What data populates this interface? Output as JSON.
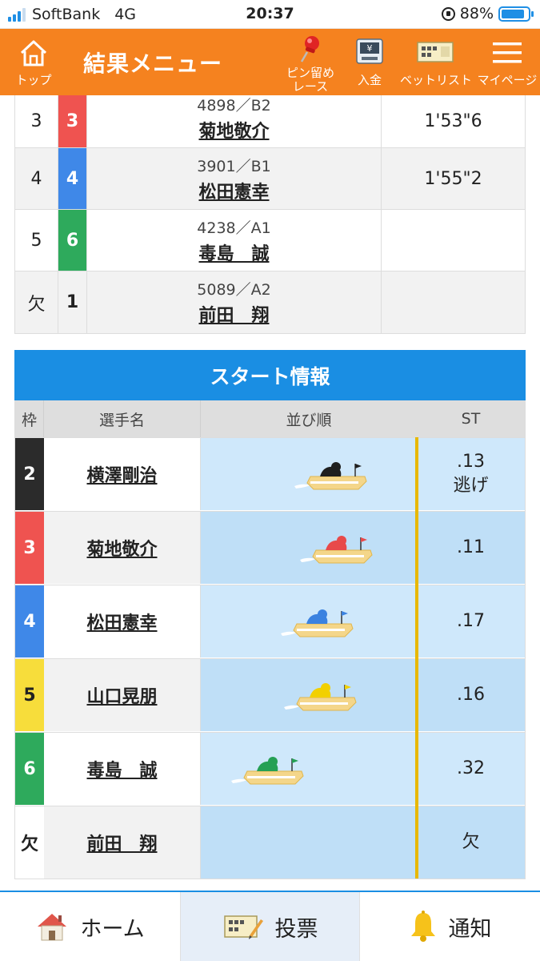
{
  "status_bar": {
    "carrier": "SoftBank",
    "network": "4G",
    "time": "20:37",
    "battery": "88%",
    "battery_level": 0.88
  },
  "header": {
    "top_label": "トップ",
    "title": "結果メニュー",
    "pin_label_1": "ピン留め",
    "pin_label_2": "レース",
    "deposit_label": "入金",
    "betlist_label": "ベットリスト",
    "mypage_label": "マイページ"
  },
  "results": [
    {
      "rank": "3",
      "lane": "3",
      "reg": "4898／B2",
      "name": "菊地敬介",
      "time": "1'53\"6",
      "lane_color": "#ef5350"
    },
    {
      "rank": "4",
      "lane": "4",
      "reg": "3901／B1",
      "name": "松田憲幸",
      "time": "1'55\"2",
      "lane_color": "#3f88e8"
    },
    {
      "rank": "5",
      "lane": "6",
      "reg": "4238／A1",
      "name": "毒島　誠",
      "time": "",
      "lane_color": "#2eaa5c"
    },
    {
      "rank": "欠",
      "lane": "1",
      "reg": "5089／A2",
      "name": "前田　翔",
      "time": "",
      "lane_color": "#ffffff"
    }
  ],
  "start_info": {
    "title": "スタート情報",
    "headers": {
      "waku": "枠",
      "name": "選手名",
      "order": "並び順",
      "st": "ST"
    },
    "rows": [
      {
        "waku": "2",
        "name": "横澤剛治",
        "st": ".13",
        "note": "逃げ",
        "color": "#2b2b2b",
        "boat_color": "#1f1f1f"
      },
      {
        "waku": "3",
        "name": "菊地敬介",
        "st": ".11",
        "note": "",
        "color": "#ef5350",
        "boat_color": "#e84a4a"
      },
      {
        "waku": "4",
        "name": "松田憲幸",
        "st": ".17",
        "note": "",
        "color": "#3f88e8",
        "boat_color": "#3b82e0"
      },
      {
        "waku": "5",
        "name": "山口晃朋",
        "st": ".16",
        "note": "",
        "color": "#f7dd3b",
        "boat_color": "#f2d000"
      },
      {
        "waku": "6",
        "name": "毒島　誠",
        "st": ".32",
        "note": "",
        "color": "#2eaa5c",
        "boat_color": "#25a055"
      },
      {
        "waku": "欠",
        "name": "前田　翔",
        "st": "欠",
        "note": "",
        "color": "#ffffff",
        "boat_color": ""
      }
    ]
  },
  "bottom_nav": {
    "home": "ホーム",
    "vote": "投票",
    "notify": "通知"
  }
}
